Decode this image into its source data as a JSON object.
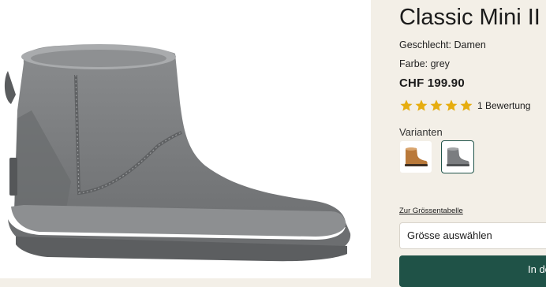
{
  "product": {
    "title": "Classic Mini II",
    "gender": "Geschlecht: Damen",
    "color": "Farbe: grey",
    "price": "CHF 199.90",
    "rating": {
      "stars": 5,
      "max": 5,
      "text": "1 Bewertung",
      "star_color": "#e6ad0f"
    },
    "variants_label": "Varianten",
    "variants": [
      {
        "name": "chestnut",
        "color": "#b9793a"
      },
      {
        "name": "grey",
        "color": "#7b7d80",
        "selected": true
      }
    ],
    "size_chart_link": "Zur Grössentabelle",
    "size_select": "Grösse auswählen",
    "cart_button": "In de"
  },
  "colors": {
    "accent": "#1f5247",
    "panel": "#f3efe7",
    "boot": "#7b7e80"
  }
}
